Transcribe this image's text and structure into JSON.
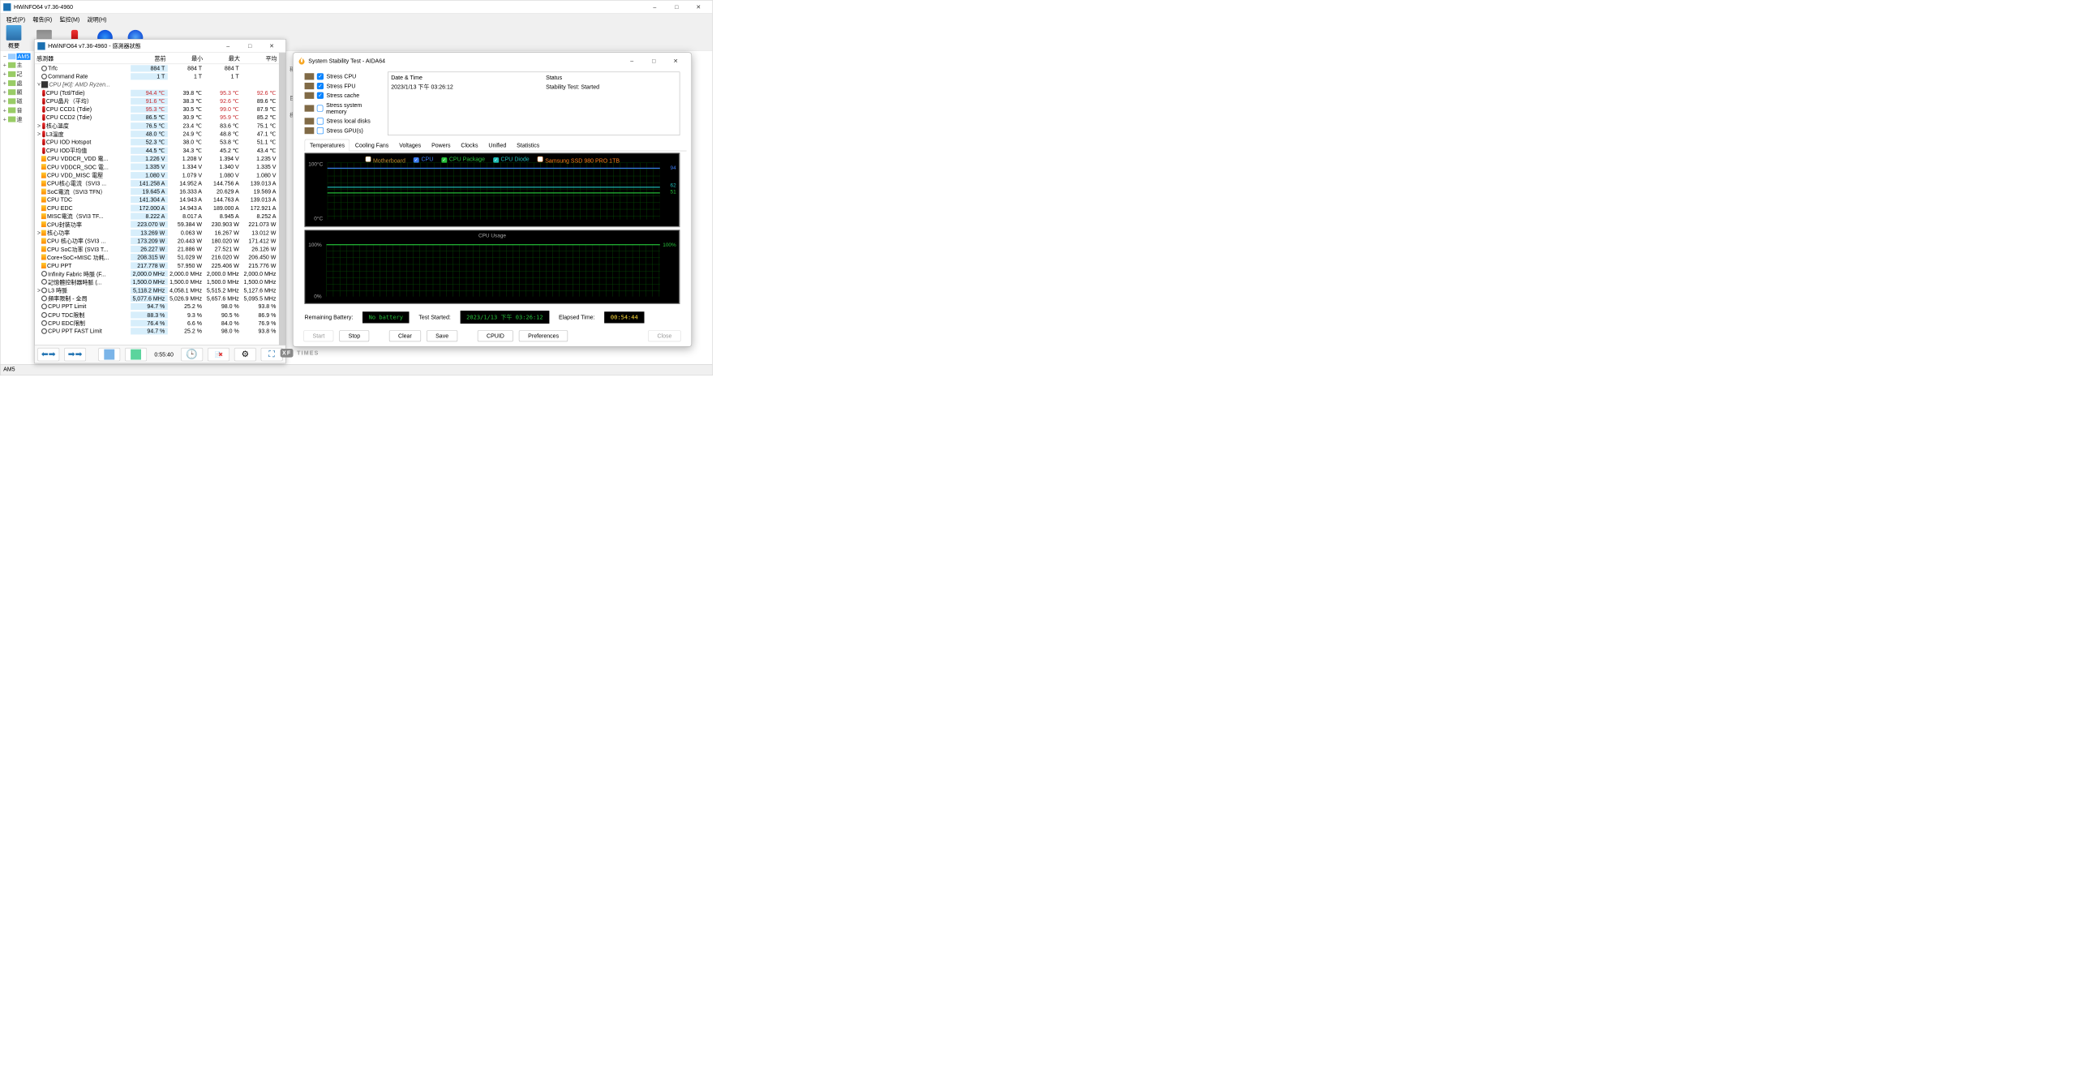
{
  "main": {
    "title": "HWiNFO64 v7.36-4960",
    "menus": [
      "程式(P)",
      "報告(R)",
      "監控(M)",
      "說明(H)"
    ],
    "tool_summary": "概要",
    "status": "AM5"
  },
  "tree": {
    "root": "AM5",
    "nodes": [
      "主",
      "記",
      "處",
      "顯",
      "磁",
      "音",
      "連"
    ]
  },
  "sensor": {
    "title": "HWiNFO64 v7.36-4960 - 感測器狀態",
    "cols": {
      "name": "感測器",
      "cur": "當前",
      "min": "最小",
      "max": "最大",
      "avg": "平均"
    },
    "rows": [
      {
        "ic": "cl",
        "nm": "Trfc",
        "cc": "884 T",
        "mn": "884 T",
        "mx": "884 T",
        "av": ""
      },
      {
        "ic": "cl",
        "nm": "Command Rate",
        "cc": "1 T",
        "mn": "1 T",
        "mx": "1 T",
        "av": ""
      },
      {
        "grp": true,
        "nm": "CPU [#0]: AMD Ryzen..."
      },
      {
        "ic": "th",
        "nm": "CPU (Tctl/Tdie)",
        "cc": "94.4 ℃",
        "mn": "39.8 ℃",
        "mx": "95.3 ℃",
        "av": "92.6 ℃",
        "hotc": true,
        "hotm": true,
        "hota": true
      },
      {
        "ic": "th",
        "nm": "CPU晶片（平均）",
        "cc": "91.6 ℃",
        "mn": "38.3 ℃",
        "mx": "92.6 ℃",
        "av": "89.6 ℃",
        "hotc": true,
        "hotm": true
      },
      {
        "ic": "th",
        "nm": "CPU CCD1 (Tdie)",
        "cc": "95.3 ℃",
        "mn": "30.5 ℃",
        "mx": "99.0 ℃",
        "av": "87.9 ℃",
        "hotc": true,
        "hotm": true
      },
      {
        "ic": "th",
        "nm": "CPU CCD2 (Tdie)",
        "cc": "86.5 ℃",
        "mn": "30.9 ℃",
        "mx": "95.9 ℃",
        "av": "85.2 ℃",
        "hotm": true
      },
      {
        "ic": "th",
        "ind": ">",
        "nm": "核心溫度",
        "cc": "76.5 ℃",
        "mn": "23.4 ℃",
        "mx": "83.6 ℃",
        "av": "75.1 ℃"
      },
      {
        "ic": "th",
        "ind": ">",
        "nm": "L3溫度",
        "cc": "48.0 ℃",
        "mn": "24.9 ℃",
        "mx": "48.8 ℃",
        "av": "47.1 ℃"
      },
      {
        "ic": "th",
        "nm": "CPU IOD Hotspot",
        "cc": "52.3 ℃",
        "mn": "38.0 ℃",
        "mx": "53.8 ℃",
        "av": "51.1 ℃"
      },
      {
        "ic": "th",
        "nm": "CPU IOD平均值",
        "cc": "44.5 ℃",
        "mn": "34.3 ℃",
        "mx": "45.2 ℃",
        "av": "43.4 ℃"
      },
      {
        "ic": "vt",
        "nm": "CPU VDDCR_VDD 電...",
        "cc": "1.226 V",
        "mn": "1.208 V",
        "mx": "1.394 V",
        "av": "1.235 V"
      },
      {
        "ic": "vt",
        "nm": "CPU VDDCR_SOC 電...",
        "cc": "1.335 V",
        "mn": "1.334 V",
        "mx": "1.340 V",
        "av": "1.335 V"
      },
      {
        "ic": "vt",
        "nm": "CPU VDD_MISC 電壓",
        "cc": "1.080 V",
        "mn": "1.079 V",
        "mx": "1.080 V",
        "av": "1.080 V"
      },
      {
        "ic": "vt",
        "nm": "CPU核心電流（SVI3 ...",
        "cc": "141.258 A",
        "mn": "14.952 A",
        "mx": "144.756 A",
        "av": "139.013 A"
      },
      {
        "ic": "vt",
        "nm": "SoC電流（SVI3 TFN）",
        "cc": "19.645 A",
        "mn": "16.333 A",
        "mx": "20.629 A",
        "av": "19.569 A"
      },
      {
        "ic": "vt",
        "nm": "CPU TDC",
        "cc": "141.304 A",
        "mn": "14.943 A",
        "mx": "144.763 A",
        "av": "139.013 A"
      },
      {
        "ic": "vt",
        "nm": "CPU EDC",
        "cc": "172.000 A",
        "mn": "14.943 A",
        "mx": "189.000 A",
        "av": "172.921 A"
      },
      {
        "ic": "vt",
        "nm": "MISC電流（SVI3 TF...",
        "cc": "8.222 A",
        "mn": "8.017 A",
        "mx": "8.945 A",
        "av": "8.252 A"
      },
      {
        "ic": "vt",
        "nm": "CPU封裝功率",
        "cc": "223.070 W",
        "mn": "59.384 W",
        "mx": "230.903 W",
        "av": "221.073 W"
      },
      {
        "ic": "vt",
        "ind": ">",
        "nm": "核心功率",
        "cc": "13.269 W",
        "mn": "0.063 W",
        "mx": "16.267 W",
        "av": "13.012 W"
      },
      {
        "ic": "vt",
        "nm": "CPU 核心功率 (SVI3 ...",
        "cc": "173.209 W",
        "mn": "20.443 W",
        "mx": "180.020 W",
        "av": "171.412 W"
      },
      {
        "ic": "vt",
        "nm": "CPU SoC功率 (SVI3 T...",
        "cc": "26.227 W",
        "mn": "21.886 W",
        "mx": "27.521 W",
        "av": "26.126 W"
      },
      {
        "ic": "vt",
        "nm": "Core+SoC+MISC 功耗...",
        "cc": "208.315 W",
        "mn": "51.029 W",
        "mx": "216.020 W",
        "av": "206.450 W"
      },
      {
        "ic": "vt",
        "nm": "CPU PPT",
        "cc": "217.778 W",
        "mn": "57.950 W",
        "mx": "225.406 W",
        "av": "215.776 W"
      },
      {
        "ic": "cl",
        "nm": "Infinity Fabric 時脈 (F...",
        "cc": "2,000.0 MHz",
        "mn": "2,000.0 MHz",
        "mx": "2,000.0 MHz",
        "av": "2,000.0 MHz"
      },
      {
        "ic": "cl",
        "nm": "記憶體控制器時脈 (...",
        "cc": "1,500.0 MHz",
        "mn": "1,500.0 MHz",
        "mx": "1,500.0 MHz",
        "av": "1,500.0 MHz"
      },
      {
        "ic": "cl",
        "ind": ">",
        "nm": "L3 時脈",
        "cc": "5,118.2 MHz",
        "mn": "4,058.1 MHz",
        "mx": "5,515.2 MHz",
        "av": "5,127.6 MHz"
      },
      {
        "ic": "cl",
        "nm": "頻率限制 - 全局",
        "cc": "5,077.6 MHz",
        "mn": "5,026.9 MHz",
        "mx": "5,657.6 MHz",
        "av": "5,095.5 MHz"
      },
      {
        "ic": "cl",
        "nm": "CPU PPT Limit",
        "cc": "94.7 %",
        "mn": "25.2 %",
        "mx": "98.0 %",
        "av": "93.8 %"
      },
      {
        "ic": "cl",
        "nm": "CPU TDC限制",
        "cc": "88.3 %",
        "mn": "9.3 %",
        "mx": "90.5 %",
        "av": "86.9 %"
      },
      {
        "ic": "cl",
        "nm": "CPU EDC限制",
        "cc": "76.4 %",
        "mn": "6.6 %",
        "mx": "84.0 %",
        "av": "76.9 %"
      },
      {
        "ic": "cl",
        "nm": "CPU PPT FAST Limit",
        "cc": "94.7 %",
        "mn": "25.2 %",
        "mx": "98.0 %",
        "av": "93.8 %"
      }
    ],
    "elapsed": "0:55:40"
  },
  "aida": {
    "title": "System Stability Test - AIDA64",
    "stress": [
      {
        "k": "cpu",
        "lbl": "Stress CPU",
        "on": true
      },
      {
        "k": "fpu",
        "lbl": "Stress FPU",
        "on": true
      },
      {
        "k": "cache",
        "lbl": "Stress cache",
        "on": true
      },
      {
        "k": "mem",
        "lbl": "Stress system memory",
        "on": false
      },
      {
        "k": "disk",
        "lbl": "Stress local disks",
        "on": false
      },
      {
        "k": "gpu",
        "lbl": "Stress GPU(s)",
        "on": false
      }
    ],
    "log": {
      "h1": "Date & Time",
      "h2": "Status",
      "dt": "2023/1/13 下午 03:26:12",
      "st": "Stability Test: Started"
    },
    "tabs": [
      "Temperatures",
      "Cooling Fans",
      "Voltages",
      "Powers",
      "Clocks",
      "Unified",
      "Statistics"
    ],
    "legend": [
      "Motherboard",
      "CPU",
      "CPU Package",
      "CPU Diode",
      "Samsung SSD 980 PRO 1TB"
    ],
    "legend_on": [
      false,
      true,
      true,
      true,
      false
    ],
    "legend_colors": [
      "#c08a2e",
      "#3b7af0",
      "#26c13a",
      "#1fbcb8",
      "#ff7d1a"
    ],
    "g1": {
      "top": "100°C",
      "bot": "0°C",
      "r1": "94",
      "r2": "62",
      "r3": "51"
    },
    "g2": {
      "title": "CPU Usage",
      "left": "100%",
      "bot": "0%",
      "right": "100%"
    },
    "info": {
      "batt_lbl": "Remaining Battery:",
      "batt": "No battery",
      "start_lbl": "Test Started:",
      "start": "2023/1/13 下午 03:26:12",
      "el_lbl": "Elapsed Time:",
      "el": "00:54:44"
    },
    "btns": {
      "start": "Start",
      "stop": "Stop",
      "clear": "Clear",
      "save": "Save",
      "cpuid": "CPUID",
      "pref": "Preferences",
      "close": "Close"
    }
  },
  "watermark": "TIMES"
}
